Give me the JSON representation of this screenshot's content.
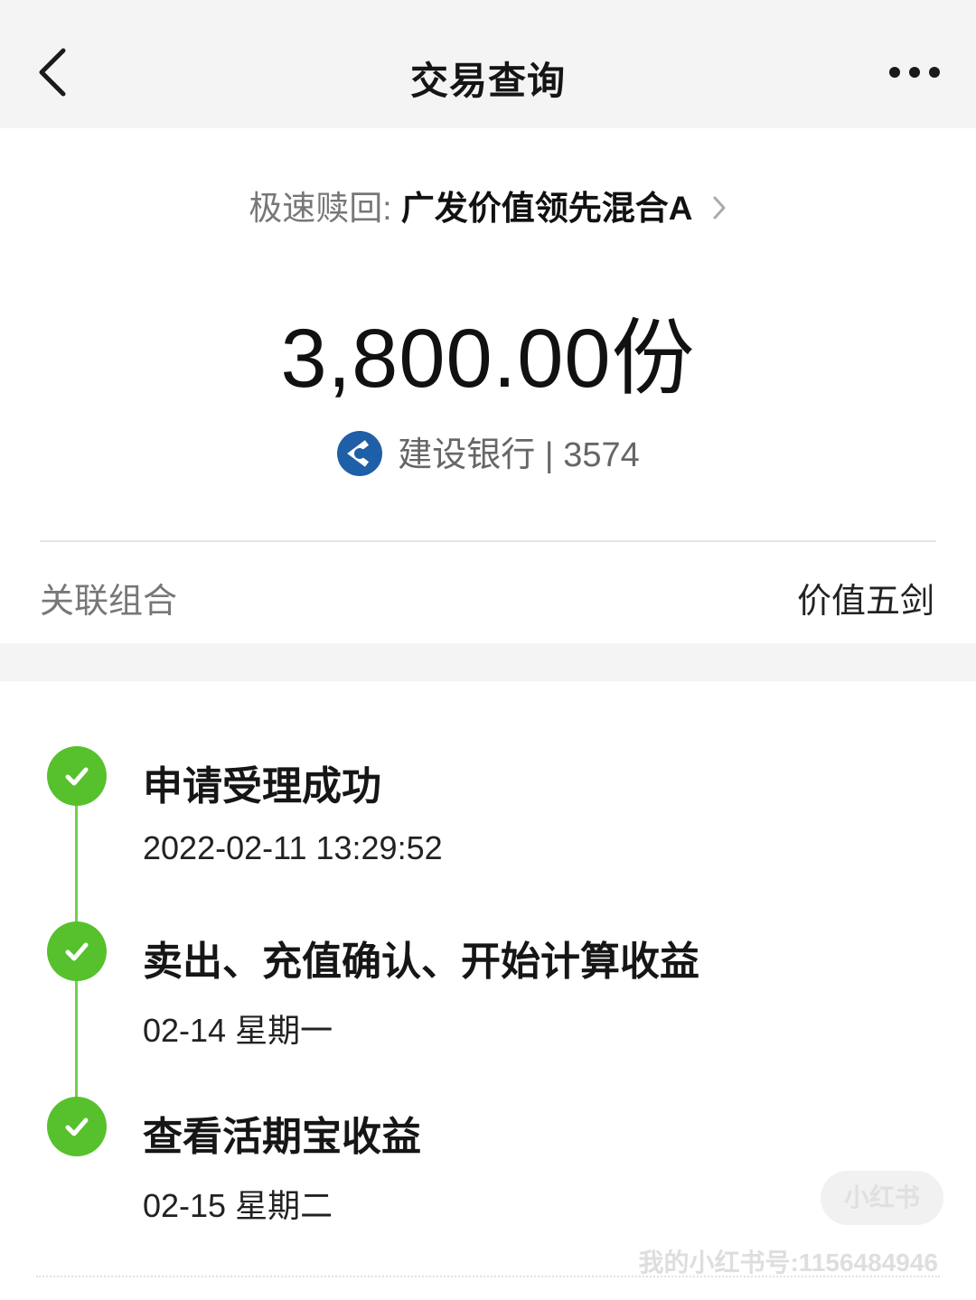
{
  "header": {
    "title": "交易查询"
  },
  "fund": {
    "prefix": "极速赎回: ",
    "name": "广发价值领先混合A"
  },
  "amount": "3,800.00份",
  "bank": {
    "name": "建设银行",
    "separator": " | ",
    "card_suffix": "3574",
    "logo_color": "#1f5fa8"
  },
  "association": {
    "label": "关联组合",
    "value": "价值五剑"
  },
  "timeline": [
    {
      "title": "申请受理成功",
      "time": "2022-02-11 13:29:52",
      "status": "done"
    },
    {
      "title": "卖出、充值确认、开始计算收益",
      "time": "02-14 星期一",
      "status": "done"
    },
    {
      "title": "查看活期宝收益",
      "time": "02-15 星期二",
      "status": "done"
    }
  ],
  "watermark": {
    "badge": "小红书",
    "text": "我的小红书号:1156484946"
  },
  "colors": {
    "accent_green": "#56c12c",
    "background_gray": "#f4f4f4"
  }
}
